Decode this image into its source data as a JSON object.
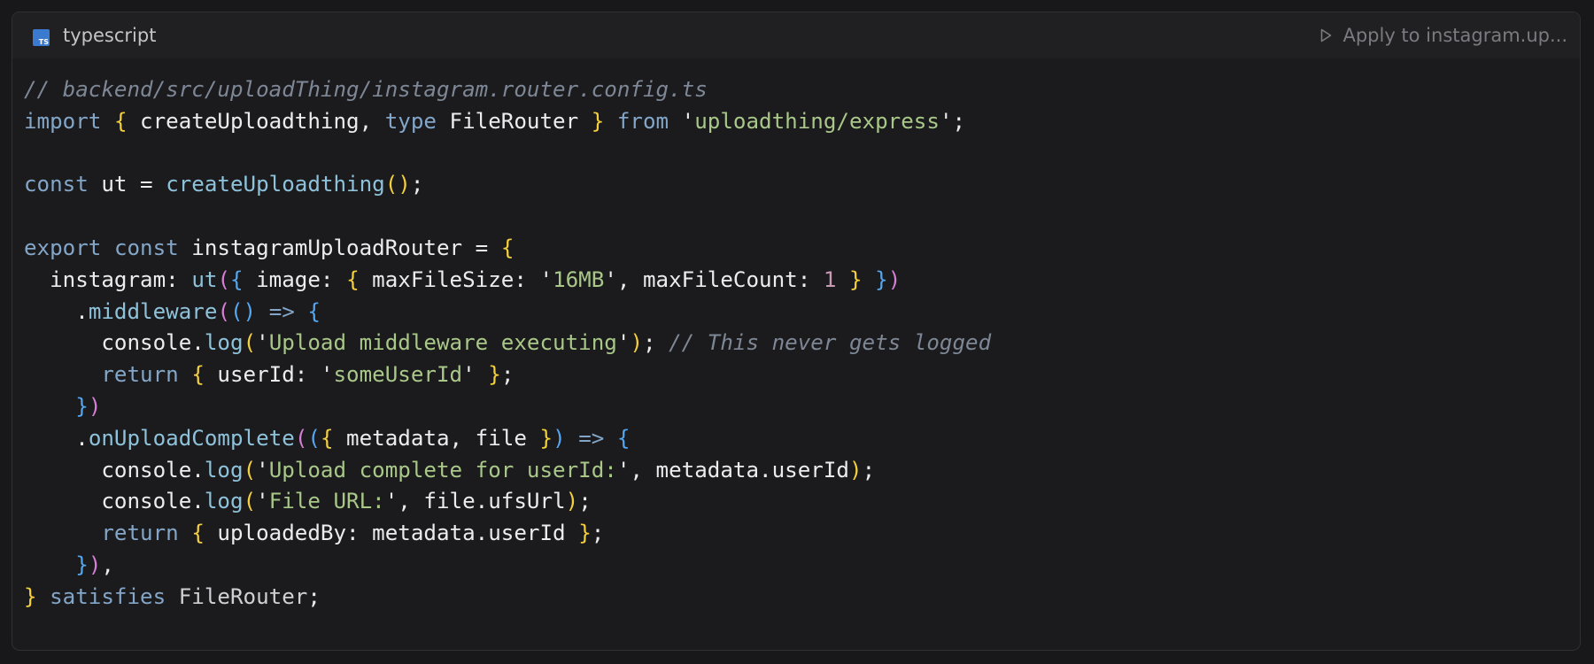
{
  "header": {
    "language": "typescript",
    "language_badge": "TS",
    "apply_label": "Apply to instagram.up..."
  },
  "colors": {
    "comment": "#7e8796",
    "keyword": "#83a6c8",
    "function": "#8ec2da",
    "string": "#a8c788",
    "number": "#c89bb5",
    "bracket_level_1": "#f4d03f",
    "bracket_level_2": "#d77fd6",
    "bracket_level_3": "#55a7ef"
  },
  "code": {
    "lines": [
      [
        [
          "comment",
          "// backend/src/uploadThing/instagram.router.config.ts"
        ]
      ],
      [
        [
          "keyword",
          "import"
        ],
        [
          "plain",
          " "
        ],
        [
          "b1",
          "{"
        ],
        [
          "plain",
          " createUploadthing, "
        ],
        [
          "keyword",
          "type"
        ],
        [
          "plain",
          " FileRouter "
        ],
        [
          "b1",
          "}"
        ],
        [
          "plain",
          " "
        ],
        [
          "keyword",
          "from"
        ],
        [
          "plain",
          " '"
        ],
        [
          "string",
          "uploadthing/express"
        ],
        [
          "plain",
          "';"
        ]
      ],
      [],
      [
        [
          "keyword",
          "const"
        ],
        [
          "plain",
          " ut = "
        ],
        [
          "func",
          "createUploadthing"
        ],
        [
          "b1",
          "()"
        ],
        [
          "plain",
          ";"
        ]
      ],
      [],
      [
        [
          "keyword",
          "export"
        ],
        [
          "plain",
          " "
        ],
        [
          "keyword",
          "const"
        ],
        [
          "plain",
          " instagramUploadRouter = "
        ],
        [
          "b1",
          "{"
        ]
      ],
      [
        [
          "plain",
          "  instagram: "
        ],
        [
          "func",
          "ut"
        ],
        [
          "b2",
          "("
        ],
        [
          "b3",
          "{"
        ],
        [
          "plain",
          " image: "
        ],
        [
          "b1",
          "{"
        ],
        [
          "plain",
          " maxFileSize: '"
        ],
        [
          "string",
          "16MB"
        ],
        [
          "plain",
          "', maxFileCount: "
        ],
        [
          "number",
          "1"
        ],
        [
          "plain",
          " "
        ],
        [
          "b1",
          "}"
        ],
        [
          "plain",
          " "
        ],
        [
          "b3",
          "}"
        ],
        [
          "b2",
          ")"
        ]
      ],
      [
        [
          "plain",
          "    ."
        ],
        [
          "func",
          "middleware"
        ],
        [
          "b2",
          "("
        ],
        [
          "b3",
          "()"
        ],
        [
          "plain",
          " "
        ],
        [
          "keyword",
          "=>"
        ],
        [
          "plain",
          " "
        ],
        [
          "b3",
          "{"
        ]
      ],
      [
        [
          "plain",
          "      console."
        ],
        [
          "func",
          "log"
        ],
        [
          "b1",
          "("
        ],
        [
          "plain",
          "'"
        ],
        [
          "string",
          "Upload middleware executing"
        ],
        [
          "plain",
          "'"
        ],
        [
          "b1",
          ")"
        ],
        [
          "plain",
          "; "
        ],
        [
          "comment",
          "// This never gets logged"
        ]
      ],
      [
        [
          "plain",
          "      "
        ],
        [
          "keyword",
          "return"
        ],
        [
          "plain",
          " "
        ],
        [
          "b1",
          "{"
        ],
        [
          "plain",
          " userId: '"
        ],
        [
          "string",
          "someUserId"
        ],
        [
          "plain",
          "' "
        ],
        [
          "b1",
          "}"
        ],
        [
          "plain",
          ";"
        ]
      ],
      [
        [
          "plain",
          "    "
        ],
        [
          "b3",
          "}"
        ],
        [
          "b2",
          ")"
        ]
      ],
      [
        [
          "plain",
          "    ."
        ],
        [
          "func",
          "onUploadComplete"
        ],
        [
          "b2",
          "("
        ],
        [
          "b3",
          "("
        ],
        [
          "b1",
          "{"
        ],
        [
          "plain",
          " metadata, file "
        ],
        [
          "b1",
          "}"
        ],
        [
          "b3",
          ")"
        ],
        [
          "plain",
          " "
        ],
        [
          "keyword",
          "=>"
        ],
        [
          "plain",
          " "
        ],
        [
          "b3",
          "{"
        ]
      ],
      [
        [
          "plain",
          "      console."
        ],
        [
          "func",
          "log"
        ],
        [
          "b1",
          "("
        ],
        [
          "plain",
          "'"
        ],
        [
          "string",
          "Upload complete for userId:"
        ],
        [
          "plain",
          "', metadata.userId"
        ],
        [
          "b1",
          ")"
        ],
        [
          "plain",
          ";"
        ]
      ],
      [
        [
          "plain",
          "      console."
        ],
        [
          "func",
          "log"
        ],
        [
          "b1",
          "("
        ],
        [
          "plain",
          "'"
        ],
        [
          "string",
          "File URL:"
        ],
        [
          "plain",
          "', file.ufsUrl"
        ],
        [
          "b1",
          ")"
        ],
        [
          "plain",
          ";"
        ]
      ],
      [
        [
          "plain",
          "      "
        ],
        [
          "keyword",
          "return"
        ],
        [
          "plain",
          " "
        ],
        [
          "b1",
          "{"
        ],
        [
          "plain",
          " uploadedBy: metadata.userId "
        ],
        [
          "b1",
          "}"
        ],
        [
          "plain",
          ";"
        ]
      ],
      [
        [
          "plain",
          "    "
        ],
        [
          "b3",
          "}"
        ],
        [
          "b2",
          ")"
        ],
        [
          "plain",
          ","
        ]
      ],
      [
        [
          "b1",
          "}"
        ],
        [
          "plain",
          " "
        ],
        [
          "keyword",
          "satisfies"
        ],
        [
          "plain",
          " "
        ],
        [
          "type",
          "FileRouter"
        ],
        [
          "plain",
          ";"
        ]
      ]
    ]
  }
}
